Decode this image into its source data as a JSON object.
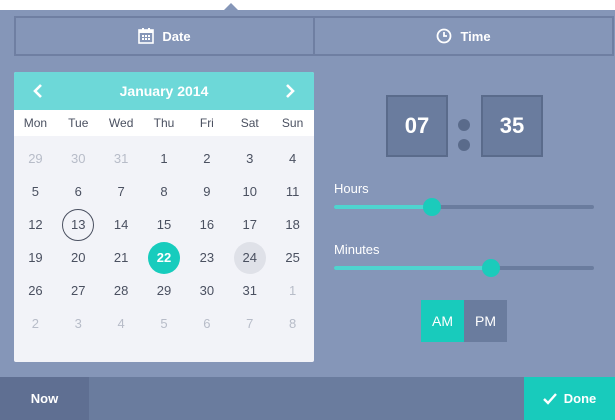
{
  "tabs": [
    {
      "label": "Date",
      "icon": "calendar-icon"
    },
    {
      "label": "Time",
      "icon": "clock-icon"
    }
  ],
  "calendar": {
    "month_label": "January 2014",
    "weekdays": [
      "Mon",
      "Tue",
      "Wed",
      "Thu",
      "Fri",
      "Sat",
      "Sun"
    ],
    "weeks": [
      [
        {
          "d": "29",
          "muted": true
        },
        {
          "d": "30",
          "muted": true
        },
        {
          "d": "31",
          "muted": true
        },
        {
          "d": "1"
        },
        {
          "d": "2"
        },
        {
          "d": "3"
        },
        {
          "d": "4"
        }
      ],
      [
        {
          "d": "5"
        },
        {
          "d": "6"
        },
        {
          "d": "7"
        },
        {
          "d": "8"
        },
        {
          "d": "9"
        },
        {
          "d": "10"
        },
        {
          "d": "11"
        }
      ],
      [
        {
          "d": "12"
        },
        {
          "d": "13",
          "today": true
        },
        {
          "d": "14"
        },
        {
          "d": "15"
        },
        {
          "d": "16"
        },
        {
          "d": "17"
        },
        {
          "d": "18"
        }
      ],
      [
        {
          "d": "19"
        },
        {
          "d": "20"
        },
        {
          "d": "21"
        },
        {
          "d": "22",
          "selected": true
        },
        {
          "d": "23"
        },
        {
          "d": "24",
          "highlight": true
        },
        {
          "d": "25"
        }
      ],
      [
        {
          "d": "26"
        },
        {
          "d": "27"
        },
        {
          "d": "28"
        },
        {
          "d": "29"
        },
        {
          "d": "30"
        },
        {
          "d": "31"
        },
        {
          "d": "1",
          "muted": true
        }
      ],
      [
        {
          "d": "2",
          "muted": true
        },
        {
          "d": "3",
          "muted": true
        },
        {
          "d": "4",
          "muted": true
        },
        {
          "d": "5",
          "muted": true
        },
        {
          "d": "6",
          "muted": true
        },
        {
          "d": "7",
          "muted": true
        },
        {
          "d": "8",
          "muted": true
        }
      ]
    ]
  },
  "time": {
    "hours": "07",
    "minutes": "35",
    "hours_label": "Hours",
    "minutes_label": "Minutes",
    "hours_slider_fraction": 0.375,
    "minutes_slider_fraction": 0.605,
    "am_label": "AM",
    "pm_label": "PM",
    "selected_period": "AM"
  },
  "footer": {
    "now_label": "Now",
    "done_label": "Done"
  },
  "colors": {
    "panel": "#8596b8",
    "accent": "#18cbbc",
    "calendar_header": "#6dd8d8"
  }
}
